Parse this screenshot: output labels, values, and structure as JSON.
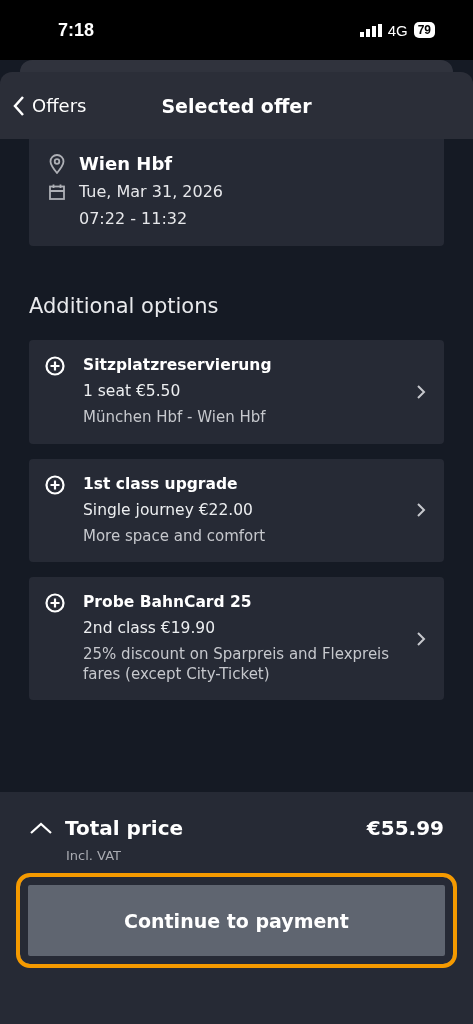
{
  "status_bar": {
    "time": "7:18",
    "network": "4G",
    "battery": "79"
  },
  "header": {
    "back_label": "Offers",
    "title": "Selected offer"
  },
  "journey": {
    "destination": "Wien Hbf",
    "date": "Tue, Mar 31, 2026",
    "times": "07:22 - 11:32"
  },
  "options_heading": "Additional options",
  "options": [
    {
      "title": "Sitzplatzreservierung",
      "price": "1 seat €5.50",
      "detail": "München Hbf - Wien Hbf"
    },
    {
      "title": "1st class upgrade",
      "price": "Single journey €22.00",
      "detail": "More space and comfort"
    },
    {
      "title": "Probe BahnCard 25",
      "price": "2nd class €19.90",
      "detail": "25% discount on Sparpreis and Flexpreis fares (except City-Ticket)"
    }
  ],
  "footer": {
    "total_label": "Total price",
    "total": "€55.99",
    "vat_note": "Incl. VAT",
    "button": {
      "label": "Continue to payment",
      "highlighted": true
    }
  }
}
